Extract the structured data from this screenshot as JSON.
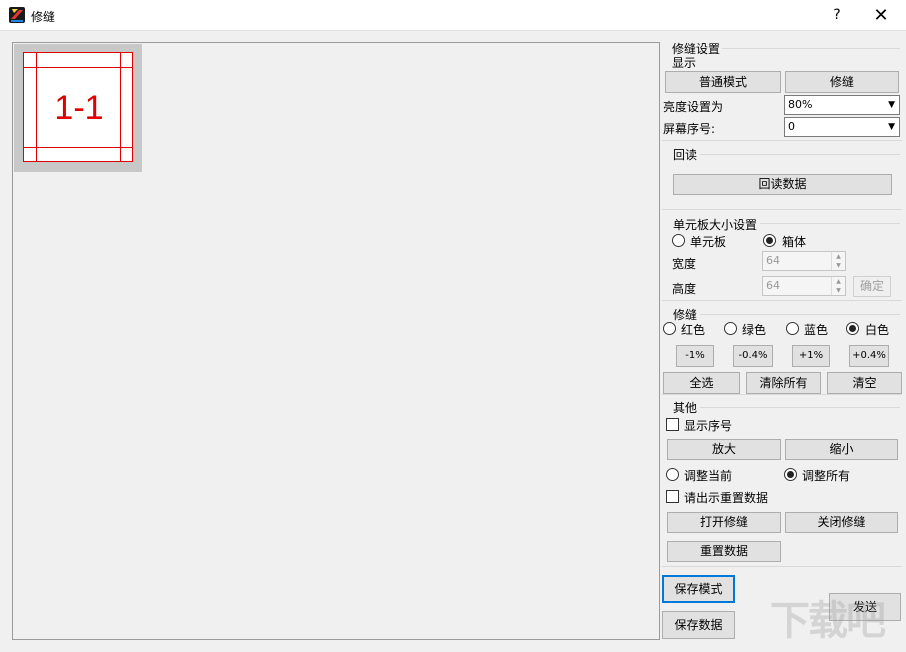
{
  "window": {
    "title": "修缝",
    "help_label": "?",
    "close_label": "✕"
  },
  "canvas": {
    "cell_label": "1-1"
  },
  "settings": {
    "section_title": "修缝设置",
    "display_group": "显示",
    "normal_mode_button": "普通模式",
    "seam_button": "修缝",
    "brightness_label": "亮度设置为",
    "brightness_value": "80%",
    "screen_index_label": "屏幕序号:",
    "screen_index_value": "0"
  },
  "readback": {
    "group": "回读",
    "button": "回读数据"
  },
  "board_size": {
    "group": "单元板大小设置",
    "unit_board_option": "单元板",
    "cabinet_option": "箱体",
    "width_label": "宽度",
    "width_value": "64",
    "height_label": "高度",
    "height_value": "64",
    "confirm_button": "确定"
  },
  "seam": {
    "group": "修缝",
    "red": "红色",
    "green": "绿色",
    "blue": "蓝色",
    "white": "白色",
    "minus_1": "-1%",
    "minus_04": "-0.4%",
    "plus_1": "+1%",
    "plus_04": "+0.4%",
    "select_all": "全选",
    "clear_all": "清除所有",
    "clear": "清空"
  },
  "other": {
    "group": "其他",
    "show_index": "显示序号",
    "zoom_in": "放大",
    "zoom_out": "缩小",
    "adjust_current": "调整当前",
    "adjust_all": "调整所有",
    "reset_prompt": "请出示重置数据",
    "open_seam": "打开修缝",
    "close_seam": "关闭修缝",
    "reset_data": "重置数据"
  },
  "footer": {
    "save_mode": "保存模式",
    "send": "发送",
    "save_data": "保存数据"
  },
  "watermark": {
    "text": "下载吧"
  },
  "colors": {
    "accent": "#0078d7",
    "seam_red": "#e00000",
    "cell_background": "#c8c8c8"
  }
}
